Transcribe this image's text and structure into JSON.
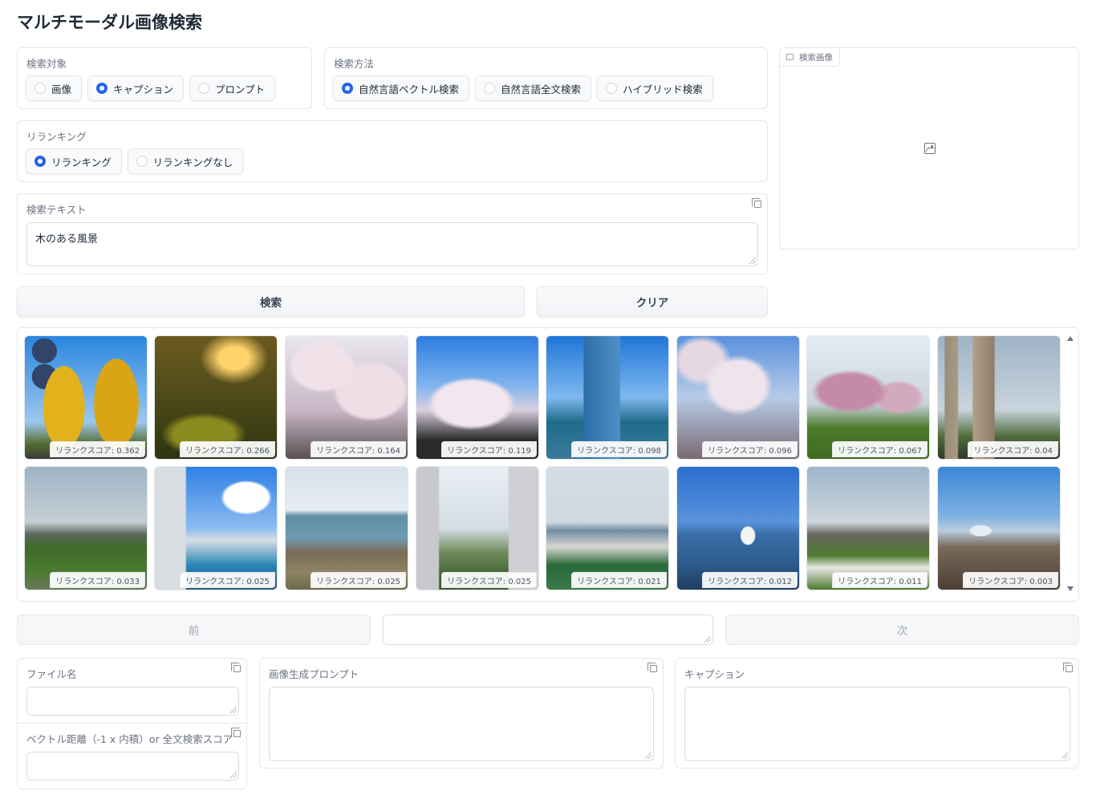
{
  "app": {
    "title": "マルチモーダル画像検索"
  },
  "search_target": {
    "label": "検索対象",
    "options": [
      "画像",
      "キャプション",
      "プロンプト"
    ],
    "selected": "キャプション"
  },
  "search_method": {
    "label": "検索方法",
    "options": [
      "自然言語ベクトル検索",
      "自然言語全文検索",
      "ハイブリッド検索"
    ],
    "selected": "自然言語ベクトル検索"
  },
  "reranking": {
    "label": "リランキング",
    "options": [
      "リランキング",
      "リランキングなし"
    ],
    "selected": "リランキング"
  },
  "search_text": {
    "label": "検索テキスト",
    "value": "木のある風景"
  },
  "search_image": {
    "label": "検索画像"
  },
  "buttons": {
    "search": "検索",
    "clear": "クリア",
    "prev": "前",
    "next": "次"
  },
  "pager": {
    "value": ""
  },
  "gallery": {
    "items": [
      {
        "score": "リランクスコア: 0.362",
        "scene": "ginkgo"
      },
      {
        "score": "リランクスコア: 0.266",
        "scene": "forest"
      },
      {
        "score": "リランクスコア: 0.164",
        "scene": "sakura"
      },
      {
        "score": "リランクスコア: 0.119",
        "scene": "sakura-sky"
      },
      {
        "score": "リランクスコア: 0.098",
        "scene": "office-towers"
      },
      {
        "score": "リランクスコア: 0.096",
        "scene": "sakura-branches"
      },
      {
        "score": "リランクスコア: 0.067",
        "scene": "sakura-park"
      },
      {
        "score": "リランクスコア: 0.04",
        "scene": "highrise-river"
      },
      {
        "score": "リランクスコア: 0.033",
        "scene": "river-skyline"
      },
      {
        "score": "リランクスコア: 0.025",
        "scene": "cyclist-city"
      },
      {
        "score": "リランクスコア: 0.025",
        "scene": "coast"
      },
      {
        "score": "リランクスコア: 0.025",
        "scene": "carp-streamers"
      },
      {
        "score": "リランクスコア: 0.021",
        "scene": "pier"
      },
      {
        "score": "リランクスコア: 0.012",
        "scene": "seagull-sea"
      },
      {
        "score": "リランクスコア: 0.011",
        "scene": "city-field"
      },
      {
        "score": "リランクスコア: 0.003",
        "scene": "fuji-city"
      }
    ]
  },
  "details": {
    "filename": {
      "label": "ファイル名",
      "value": ""
    },
    "distance": {
      "label": "ベクトル距離（-1 x 内積）or 全文検索スコア",
      "value": ""
    },
    "prompt": {
      "label": "画像生成プロンプト",
      "value": ""
    },
    "caption": {
      "label": "キャプション",
      "value": ""
    }
  },
  "colors": {
    "accent": "#2563eb",
    "border": "#e5e7eb"
  }
}
